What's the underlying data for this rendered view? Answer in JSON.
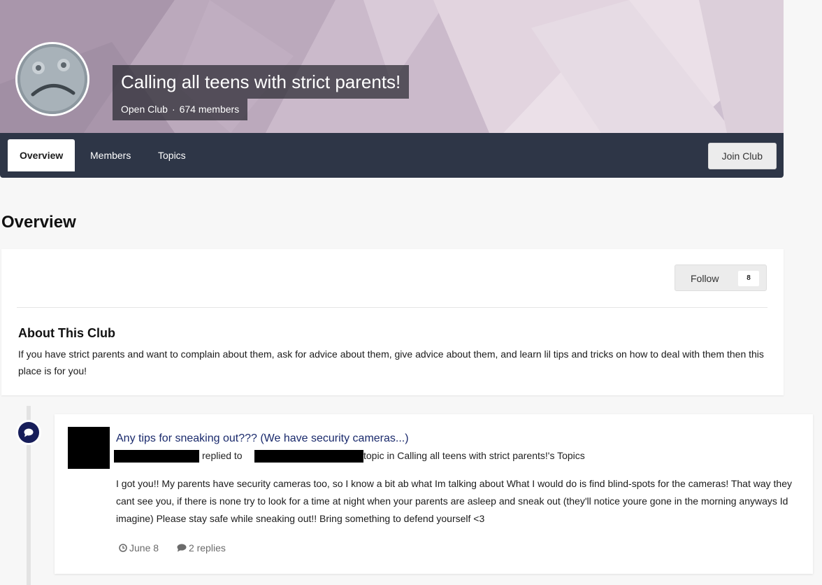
{
  "club": {
    "title": "Calling all teens with strict parents!",
    "type": "Open Club",
    "separator": "·",
    "members": "674 members"
  },
  "nav": {
    "tabs": [
      {
        "label": "Overview",
        "active": true
      },
      {
        "label": "Members",
        "active": false
      },
      {
        "label": "Topics",
        "active": false
      }
    ],
    "join_label": "Join Club"
  },
  "overview": {
    "heading": "Overview",
    "follow_label": "Follow",
    "follow_count": "8",
    "about_title": "About This Club",
    "about_text": "If you have strict parents and want to complain about them, ask for advice about them, give advice about them, and learn lil tips and tricks on how to deal with them then this place is for you!"
  },
  "activity": {
    "icon": "comment-icon",
    "title": "Any tips for sneaking out??? (We have security cameras...)",
    "replied_text": "replied to",
    "topic_text": "topic in Calling all teens with strict parents!'s Topics",
    "body": "I got you!! My parents have security cameras too, so I know a bit ab what Im talking about What I would do is find blind-spots for the cameras! That way they cant see you, if there is none try to look for a time at night when your parents are asleep and sneak out (they'll notice youre gone in the morning anyways Id imagine) Please stay safe while sneaking out!! Bring something to defend yourself <3",
    "date": "June 8",
    "replies": "2 replies"
  },
  "colors": {
    "navbar": "#2e3647",
    "link": "#1a2a6c",
    "stream_icon": "#171e5a",
    "background": "#f7f7f7"
  }
}
